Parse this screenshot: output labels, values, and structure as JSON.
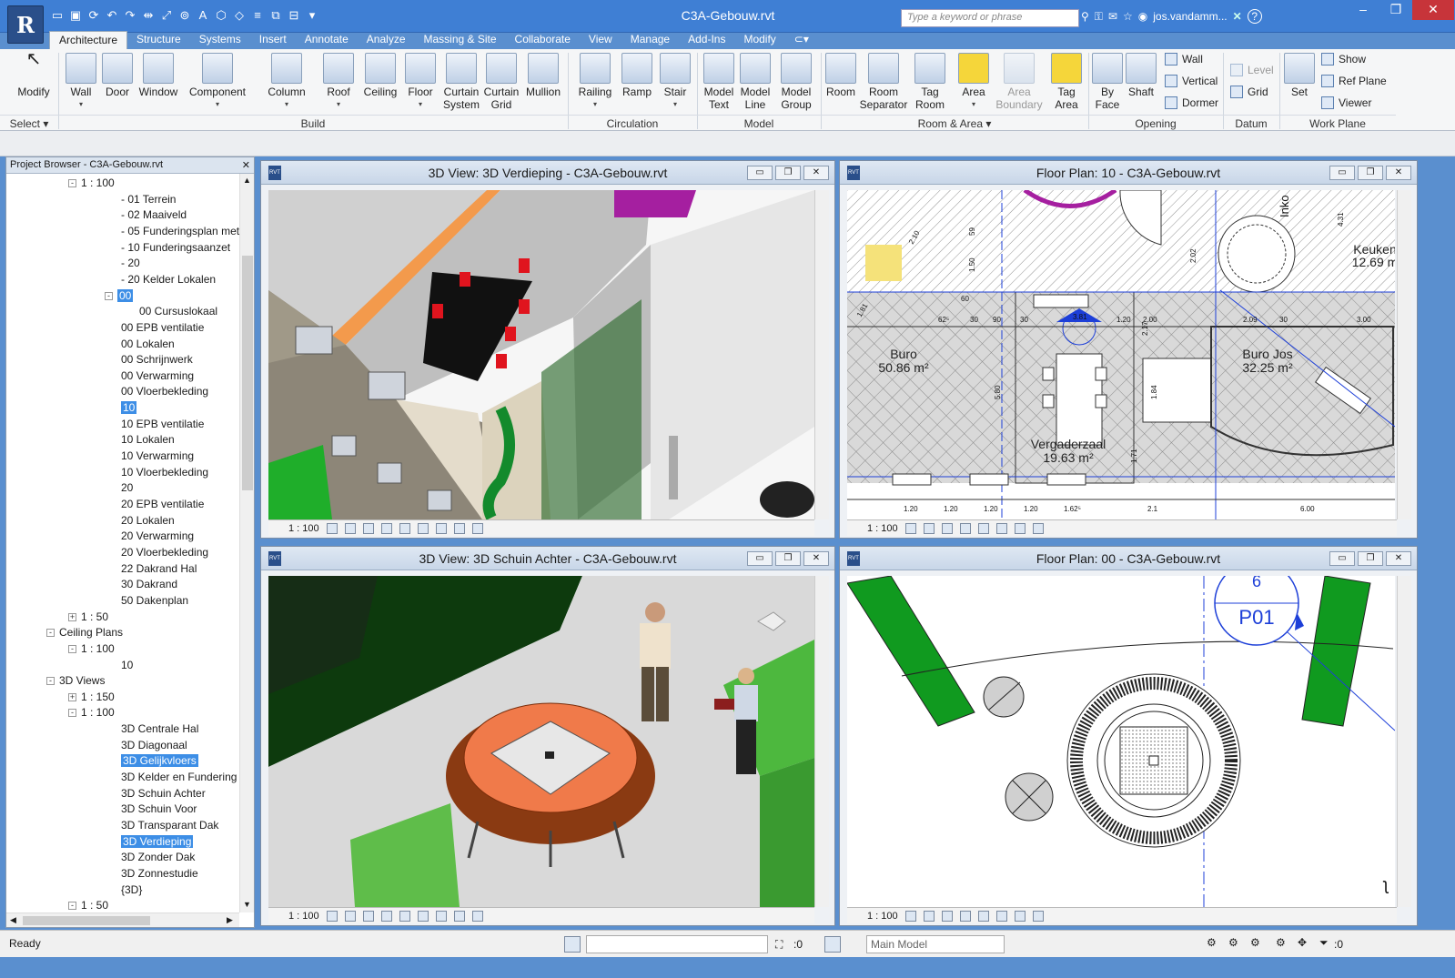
{
  "app": {
    "title": "C3A-Gebouw.rvt",
    "logo_letter": "R",
    "search_placeholder": "Type a keyword or phrase",
    "user": "jos.vandamm...",
    "help": "?"
  },
  "tabs": [
    "Architecture",
    "Structure",
    "Systems",
    "Insert",
    "Annotate",
    "Analyze",
    "Massing & Site",
    "Collaborate",
    "View",
    "Manage",
    "Add-Ins",
    "Modify"
  ],
  "ribbon": {
    "groups": {
      "select": "Select",
      "build": "Build",
      "circulation": "Circulation",
      "model": "Model",
      "room_area": "Room & Area",
      "opening": "Opening",
      "datum": "Datum",
      "work_plane": "Work Plane"
    },
    "buttons": {
      "modify": "Modify",
      "wall": "Wall",
      "door": "Door",
      "window": "Window",
      "component": "Component",
      "column": "Column",
      "roof": "Roof",
      "ceiling": "Ceiling",
      "floor": "Floor",
      "curtain_system": "Curtain System",
      "curtain_grid": "Curtain Grid",
      "mullion": "Mullion",
      "railing": "Railing",
      "ramp": "Ramp",
      "stair": "Stair",
      "model_text": "Model Text",
      "model_line": "Model Line",
      "model_group": "Model Group",
      "room": "Room",
      "room_separator": "Room Separator",
      "tag_room": "Tag Room",
      "area": "Area",
      "area_boundary": "Area Boundary",
      "tag_area": "Tag Area",
      "by_face": "By Face",
      "shaft": "Shaft",
      "opening_wall": "Wall",
      "vertical": "Vertical",
      "dormer": "Dormer",
      "level": "Level",
      "grid": "Grid",
      "set": "Set",
      "show": "Show",
      "ref_plane": "Ref  Plane",
      "viewer": "Viewer"
    }
  },
  "project_browser": {
    "title": "Project Browser - C3A-Gebouw.rvt",
    "items": [
      {
        "label": "1 : 100",
        "level": 2,
        "exp": "-"
      },
      {
        "label": "- 01 Terrein",
        "level": 3
      },
      {
        "label": "- 02 Maaiveld",
        "level": 3
      },
      {
        "label": "- 05 Funderingsplan met",
        "level": 3
      },
      {
        "label": "- 10 Funderingsaanzet",
        "level": 3
      },
      {
        "label": "- 20",
        "level": 3
      },
      {
        "label": "- 20 Kelder Lokalen",
        "level": 3
      },
      {
        "label": "00",
        "level": 3,
        "exp": "-",
        "sel": true
      },
      {
        "label": "00 Cursuslokaal",
        "level": 4
      },
      {
        "label": "00 EPB ventilatie",
        "level": 3
      },
      {
        "label": "00 Lokalen",
        "level": 3
      },
      {
        "label": "00 Schrijnwerk",
        "level": 3
      },
      {
        "label": "00 Verwarming",
        "level": 3
      },
      {
        "label": "00 Vloerbekleding",
        "level": 3
      },
      {
        "label": "10",
        "level": 3,
        "sel": true
      },
      {
        "label": "10 EPB ventilatie",
        "level": 3
      },
      {
        "label": "10 Lokalen",
        "level": 3
      },
      {
        "label": "10 Verwarming",
        "level": 3
      },
      {
        "label": "10 Vloerbekleding",
        "level": 3
      },
      {
        "label": "20",
        "level": 3
      },
      {
        "label": "20 EPB ventilatie",
        "level": 3
      },
      {
        "label": "20 Lokalen",
        "level": 3
      },
      {
        "label": "20 Verwarming",
        "level": 3
      },
      {
        "label": "20 Vloerbekleding",
        "level": 3
      },
      {
        "label": "22 Dakrand Hal",
        "level": 3
      },
      {
        "label": "30 Dakrand",
        "level": 3
      },
      {
        "label": "50 Dakenplan",
        "level": 3
      },
      {
        "label": "1 : 50",
        "level": 2,
        "exp": "+"
      },
      {
        "label": "Ceiling Plans",
        "level": 1,
        "exp": "-"
      },
      {
        "label": "1 : 100",
        "level": 2,
        "exp": "-"
      },
      {
        "label": "10",
        "level": 3
      },
      {
        "label": "3D Views",
        "level": 1,
        "exp": "-"
      },
      {
        "label": "1 : 150",
        "level": 2,
        "exp": "+"
      },
      {
        "label": "1 : 100",
        "level": 2,
        "exp": "-"
      },
      {
        "label": "3D Centrale Hal",
        "level": 3
      },
      {
        "label": "3D Diagonaal",
        "level": 3
      },
      {
        "label": "3D Gelijkvloers",
        "level": 3,
        "sel": true
      },
      {
        "label": "3D Kelder en Fundering",
        "level": 3
      },
      {
        "label": "3D Schuin Achter",
        "level": 3
      },
      {
        "label": "3D Schuin Voor",
        "level": 3
      },
      {
        "label": "3D Transparant Dak",
        "level": 3
      },
      {
        "label": "3D Verdieping",
        "level": 3,
        "sel": true
      },
      {
        "label": "3D Zonder Dak",
        "level": 3
      },
      {
        "label": "3D Zonnestudie",
        "level": 3
      },
      {
        "label": "{3D}",
        "level": 3
      },
      {
        "label": "1 : 50",
        "level": 2,
        "exp": "-"
      }
    ]
  },
  "views": {
    "v1": {
      "title": "3D View: 3D Verdieping - C3A-Gebouw.rvt",
      "scale": "1 : 100"
    },
    "v2": {
      "title": "Floor Plan: 10 - C3A-Gebouw.rvt",
      "scale": "1 : 100",
      "rooms": [
        {
          "name": "Buro",
          "area": "50.86 m²"
        },
        {
          "name": "Buro Jos",
          "area": "32.25 m²"
        },
        {
          "name": "Vergaderzaal",
          "area": "19.63 m²"
        },
        {
          "name": "Keuken",
          "area": "12.69 m"
        }
      ],
      "dims_top": [
        "62⁵",
        "30",
        "90",
        "30",
        "1.20",
        "2.00",
        "2.09",
        "30",
        "3.00"
      ],
      "dims_bottom": [
        "1.20",
        "1.20",
        "1.20",
        "1.20",
        "1.62⁵",
        "2.1",
        "6.00"
      ],
      "dims_vert": [
        "2.10",
        "59",
        "1.50",
        "1.81",
        "5.80",
        "1.84",
        "1.71",
        "2.02",
        "2.17",
        "4.31",
        "Inko"
      ],
      "dims_misc": [
        "3.81",
        "60"
      ]
    },
    "v3": {
      "title": "3D View: 3D Schuin Achter - C3A-Gebouw.rvt",
      "scale": "1 : 100"
    },
    "v4": {
      "title": "Floor Plan: 00 - C3A-Gebouw.rvt",
      "scale": "1 : 100",
      "tag_num": "6",
      "tag_code": "P01"
    }
  },
  "statusbar": {
    "ready": "Ready",
    "coord": ":0",
    "model": "Main Model",
    "filter": ":0"
  },
  "colors": {
    "titlebar": "#3f7fd4",
    "selection": "#3d8ee6",
    "green": "#1a9e2a",
    "orange": "#f39a4c",
    "red": "#e0141e"
  }
}
